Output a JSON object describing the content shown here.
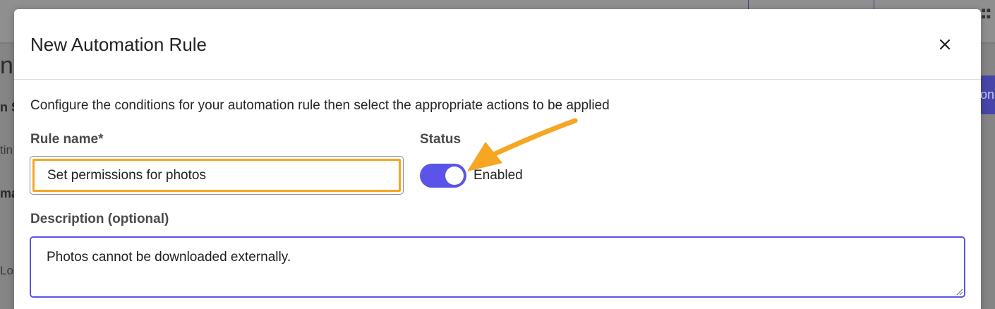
{
  "background": {
    "heading_fragment": "ng",
    "bold_fragment_1": "n S",
    "text_fragment_1": "tin",
    "bold_fragment_2": "ma",
    "text_fragment_2": "Lo",
    "action_button_fragment": "on"
  },
  "modal": {
    "title": "New Automation Rule",
    "close_icon": "close-icon",
    "intro": "Configure the conditions for your automation rule then select the appropriate actions to be applied",
    "rule_name": {
      "label": "Rule name*",
      "value": "Set permissions for photos"
    },
    "status": {
      "label": "Status",
      "toggle_label": "Enabled",
      "enabled": true
    },
    "description": {
      "label": "Description (optional)",
      "value": "Photos cannot be downloaded externally."
    }
  },
  "colors": {
    "accent": "#5a55e8",
    "highlight": "#f5a623",
    "overlay": "#858585"
  }
}
